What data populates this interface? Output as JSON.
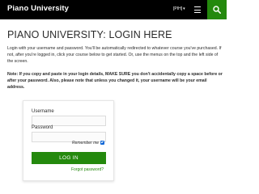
{
  "header": {
    "site_title": "Piano University",
    "language": "[PIH]",
    "menu_icon": "hamburger-menu-icon",
    "search_icon": "search-icon",
    "bar_color": "#000000",
    "accent_color": "#24890d"
  },
  "page": {
    "title": "PIANO UNIVERSITY: LOGIN HERE",
    "intro": "Login with your username and password. You'll be automatically redirected to whatever course you've purchased. If not, after you're logged in, click your course below to get started. Or, use the menus on the top and the left side of the screen.",
    "note": "Note: If you copy and paste in your login details, MAKE SURE you don't accidentally copy a space before or after your password. Also, please note that unless you changed it, your username will be your email address."
  },
  "login_form": {
    "username_label": "Username",
    "username_value": "",
    "password_label": "Password",
    "password_value": "",
    "remember_label": "Remember me",
    "remember_checked": true,
    "button_label": "LOG IN",
    "forgot_link": "Forgot password?"
  }
}
